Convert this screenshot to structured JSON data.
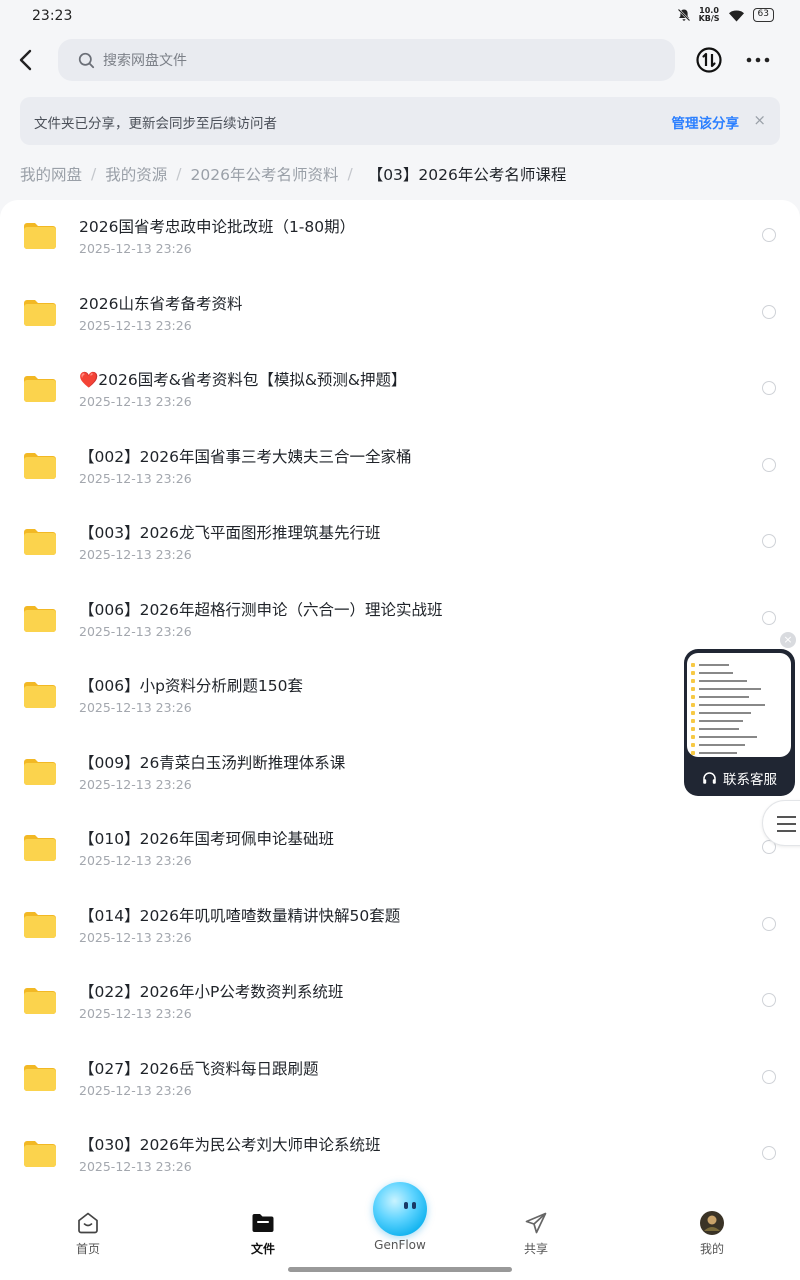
{
  "status_bar": {
    "time": "23:23",
    "net_speed_value": "10.0",
    "net_speed_unit": "KB/S",
    "battery": "63",
    "icons": [
      "mute-bell-icon",
      "wifi-icon",
      "battery-icon"
    ]
  },
  "header": {
    "search_placeholder": "搜索网盘文件",
    "icons": [
      "back-icon",
      "search-icon",
      "transfer-icon",
      "more-icon"
    ]
  },
  "banner": {
    "text": "文件夹已分享，更新会同步至后续访问者",
    "action_label": "管理该分享",
    "close_glyph": "×"
  },
  "breadcrumb": {
    "items": [
      "我的网盘",
      "我的资源",
      "2026年公考名师资料"
    ],
    "separator": "/",
    "current": "【03】2026年公考名师课程"
  },
  "files": [
    {
      "name": "2026国省考忠政申论批改班（1-80期）",
      "date": "2025-12-13  23:26"
    },
    {
      "name": "2026山东省考备考资料",
      "date": "2025-12-13  23:26"
    },
    {
      "name": "❤️2026国考&省考资料包【模拟&预测&押题】",
      "date": "2025-12-13  23:26"
    },
    {
      "name": "【002】2026年国省事三考大姨夫三合一全家桶",
      "date": "2025-12-13  23:26"
    },
    {
      "name": "【003】2026龙飞平面图形推理筑基先行班",
      "date": "2025-12-13  23:26"
    },
    {
      "name": "【006】2026年超格行测申论（六合一）理论实战班",
      "date": "2025-12-13  23:26"
    },
    {
      "name": "【006】小p资料分析刷题150套",
      "date": "2025-12-13  23:26"
    },
    {
      "name": "【009】26青菜白玉汤判断推理体系课",
      "date": "2025-12-13  23:26"
    },
    {
      "name": "【010】2026年国考珂佩申论基础班",
      "date": "2025-12-13  23:26"
    },
    {
      "name": "【014】2026年叽叽喳喳数量精讲快解50套题",
      "date": "2025-12-13  23:26"
    },
    {
      "name": "【022】2026年小P公考数资判系统班",
      "date": "2025-12-13  23:26"
    },
    {
      "name": "【027】2026岳飞资料每日跟刷题",
      "date": "2025-12-13  23:26"
    },
    {
      "name": "【030】2026年为民公考刘大师申论系统班",
      "date": "2025-12-13  23:26"
    }
  ],
  "floating_card": {
    "label": "联系客服",
    "icon": "headset-icon"
  },
  "tabbar": {
    "items": [
      {
        "label": "首页",
        "icon": "home-icon",
        "active": false
      },
      {
        "label": "文件",
        "icon": "folder-icon",
        "active": true
      },
      {
        "label": "GenFlow",
        "icon": "genflow-mascot-icon",
        "active": false
      },
      {
        "label": "共享",
        "icon": "send-icon",
        "active": false
      },
      {
        "label": "我的",
        "icon": "avatar-icon",
        "active": false
      }
    ]
  },
  "colors": {
    "accent": "#2b7fff",
    "folder": "#f7c944",
    "background": "#f5f6f8"
  }
}
